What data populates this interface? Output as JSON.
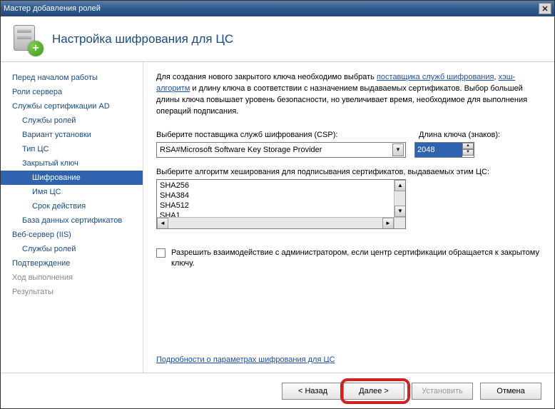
{
  "window": {
    "title": "Мастер добавления ролей"
  },
  "header": {
    "title": "Настройка шифрования для ЦС"
  },
  "sidebar": {
    "items": [
      {
        "label": "Перед началом работы",
        "indent": 0
      },
      {
        "label": "Роли сервера",
        "indent": 0
      },
      {
        "label": "Службы сертификации AD",
        "indent": 0
      },
      {
        "label": "Службы ролей",
        "indent": 1
      },
      {
        "label": "Вариант установки",
        "indent": 1
      },
      {
        "label": "Тип ЦС",
        "indent": 1
      },
      {
        "label": "Закрытый ключ",
        "indent": 1
      },
      {
        "label": "Шифрование",
        "indent": 2,
        "selected": true
      },
      {
        "label": "Имя ЦС",
        "indent": 2
      },
      {
        "label": "Срок действия",
        "indent": 2
      },
      {
        "label": "База данных сертификатов",
        "indent": 1
      },
      {
        "label": "Веб-сервер (IIS)",
        "indent": 0
      },
      {
        "label": "Службы ролей",
        "indent": 1
      },
      {
        "label": "Подтверждение",
        "indent": 0
      },
      {
        "label": "Ход выполнения",
        "indent": 0,
        "dim": true
      },
      {
        "label": "Результаты",
        "indent": 0,
        "dim": true
      }
    ]
  },
  "intro": {
    "pre": "Для создания нового закрытого ключа необходимо выбрать ",
    "link1": "поставщика служб шифрования",
    "mid": ", ",
    "link2": "хэш-алгоритм",
    "post": " и длину ключа в соответствии с назначением выдаваемых сертификатов. Выбор большей длины ключа повышает уровень безопасности, но увеличивает время, необходимое для выполнения операций подписания."
  },
  "csp": {
    "label": "Выберите поставщика служб шифрования (CSP):",
    "value": "RSA#Microsoft Software Key Storage Provider"
  },
  "keylen": {
    "label": "Длина ключа (знаков):",
    "value": "2048"
  },
  "hash": {
    "label": "Выберите алгоритм хеширования для подписывания сертификатов, выдаваемых этим ЦС:",
    "options": [
      "SHA256",
      "SHA384",
      "SHA512",
      "SHA1"
    ]
  },
  "checkbox": {
    "label": "Разрешить взаимодействие с администратором, если центр сертификации обращается к закрытому ключу."
  },
  "details_link": "Подробности о параметрах шифрования для ЦС",
  "buttons": {
    "back": "< Назад",
    "next": "Далее >",
    "install": "Установить",
    "cancel": "Отмена"
  }
}
